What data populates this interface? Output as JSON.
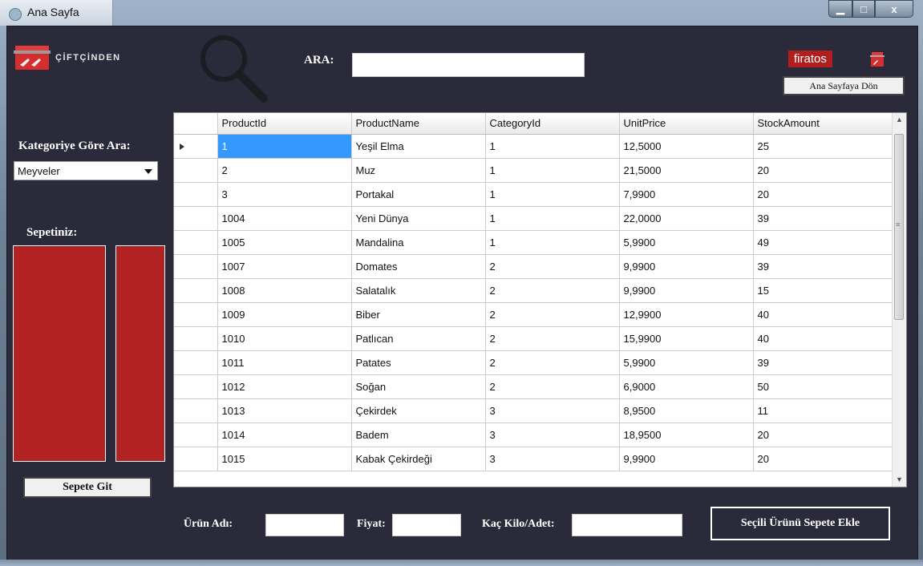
{
  "window": {
    "title": "Ana Sayfa",
    "controls": {
      "minimize": "▁",
      "maximize": "□",
      "close": "x"
    }
  },
  "header": {
    "logo_text": "ÇİFTÇİNDEN",
    "search_label": "ARA:",
    "search_value": "",
    "username": "firatos",
    "home_button": "Ana Sayfaya Dön"
  },
  "sidebar": {
    "category_label": "Kategoriye Göre Ara:",
    "category_selected": "Meyveler",
    "cart_label": "Sepetiniz:",
    "goto_cart_button": "Sepete Git"
  },
  "grid": {
    "columns": [
      "ProductId",
      "ProductName",
      "CategoryId",
      "UnitPrice",
      "StockAmount"
    ],
    "rows": [
      [
        "1",
        "Yeşil Elma",
        "1",
        "12,5000",
        "25"
      ],
      [
        "2",
        "Muz",
        "1",
        "21,5000",
        "20"
      ],
      [
        "3",
        "Portakal",
        "1",
        "7,9900",
        "20"
      ],
      [
        "1004",
        "Yeni Dünya",
        "1",
        "22,0000",
        "39"
      ],
      [
        "1005",
        "Mandalina",
        "1",
        "5,9900",
        "49"
      ],
      [
        "1007",
        "Domates",
        "2",
        "9,9900",
        "39"
      ],
      [
        "1008",
        "Salatalık",
        "2",
        "9,9900",
        "15"
      ],
      [
        "1009",
        "Biber",
        "2",
        "12,9900",
        "40"
      ],
      [
        "1010",
        "Patlıcan",
        "2",
        "15,9900",
        "40"
      ],
      [
        "1011",
        "Patates",
        "2",
        "5,9900",
        "39"
      ],
      [
        "1012",
        "Soğan",
        "2",
        "6,9000",
        "50"
      ],
      [
        "1013",
        "Çekirdek",
        "3",
        "8,9500",
        "11"
      ],
      [
        "1014",
        "Badem",
        "3",
        "18,9500",
        "20"
      ],
      [
        "1015",
        "Kabak Çekirdeği",
        "3",
        "9,9900",
        "20"
      ]
    ]
  },
  "footer": {
    "product_name_label": "Ürün Adı:",
    "price_label": "Fiyat:",
    "quantity_label": "Kaç Kilo/Adet:",
    "add_button": "Seçili Ürünü Sepete Ekle"
  },
  "colors": {
    "background": "#2a2a3a",
    "accent": "#b22222",
    "selection": "#3399ff"
  },
  "icons": {
    "app": "cart-icon",
    "search": "magnifier-icon",
    "user_cart": "cart-icon"
  }
}
